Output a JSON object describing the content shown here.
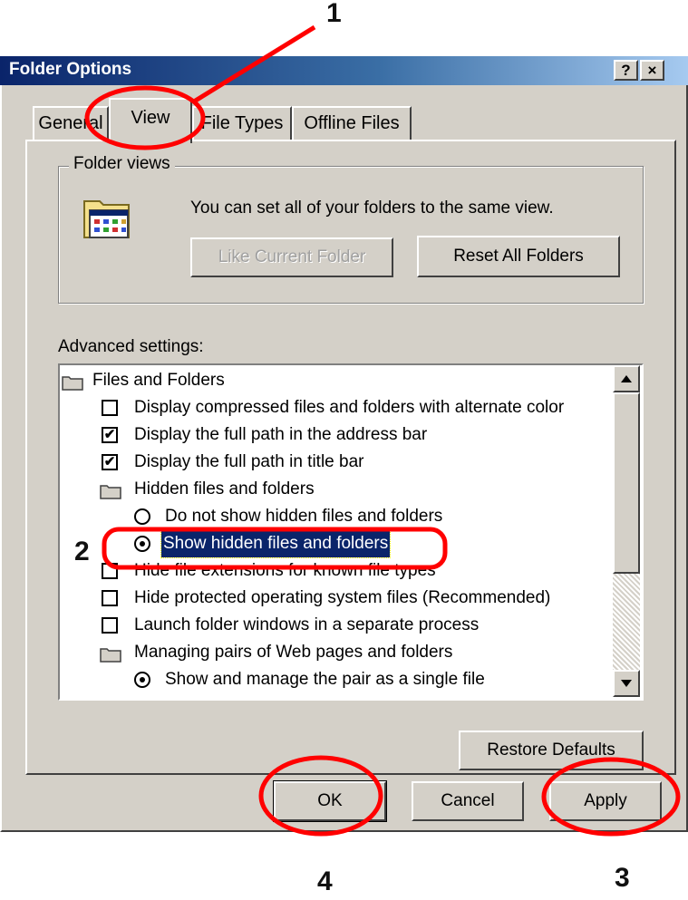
{
  "window": {
    "title": "Folder Options",
    "help_label": "?",
    "close_label": "×"
  },
  "tabs": [
    {
      "label": "General"
    },
    {
      "label": "View"
    },
    {
      "label": "File Types"
    },
    {
      "label": "Offline Files"
    }
  ],
  "folder_views": {
    "legend": "Folder views",
    "icon": "folder-view-icon",
    "description": "You can set all of your folders to the same view.",
    "like_current_label": "Like Current Folder",
    "reset_all_label": "Reset All Folders"
  },
  "advanced": {
    "label": "Advanced settings:",
    "items": [
      {
        "type": "folder",
        "label": "Files and Folders"
      },
      {
        "type": "checkbox",
        "checked": false,
        "label": "Display compressed files and folders with alternate color"
      },
      {
        "type": "checkbox",
        "checked": true,
        "label": "Display the full path in the address bar"
      },
      {
        "type": "checkbox",
        "checked": true,
        "label": "Display the full path in title bar"
      },
      {
        "type": "folder",
        "label": "Hidden files and folders"
      },
      {
        "type": "radio",
        "checked": false,
        "label": "Do not show hidden files and folders"
      },
      {
        "type": "radio",
        "checked": true,
        "selected": true,
        "label": "Show hidden files and folders"
      },
      {
        "type": "checkbox",
        "checked": false,
        "label": "Hide file extensions for known file types"
      },
      {
        "type": "checkbox",
        "checked": false,
        "label": "Hide protected operating system files (Recommended)"
      },
      {
        "type": "checkbox",
        "checked": false,
        "label": "Launch folder windows in a separate process"
      },
      {
        "type": "folder",
        "label": "Managing pairs of Web pages and folders"
      },
      {
        "type": "radio",
        "checked": true,
        "label": "Show and manage the pair as a single file"
      }
    ],
    "check_mark": "✔"
  },
  "restore_defaults_label": "Restore Defaults",
  "dialog_buttons": {
    "ok": "OK",
    "cancel": "Cancel",
    "apply": "Apply"
  },
  "annotations": {
    "step1": "1",
    "step2": "2",
    "step3": "3",
    "step4": "4",
    "color": "#ff0000"
  },
  "colors": {
    "selection": "#0a246a",
    "titlebar": "#0a246a",
    "face": "#d4d0c8"
  }
}
